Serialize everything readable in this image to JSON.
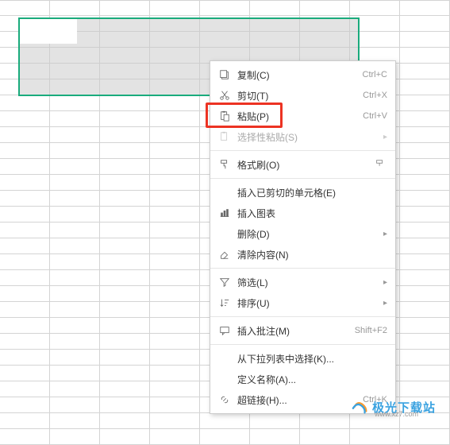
{
  "menu": {
    "copy": {
      "label": "复制(C)",
      "shortcut": "Ctrl+C"
    },
    "cut": {
      "label": "剪切(T)",
      "shortcut": "Ctrl+X"
    },
    "paste": {
      "label": "粘贴(P)",
      "shortcut": "Ctrl+V"
    },
    "paste_special": {
      "label": "选择性粘贴(S)"
    },
    "format_painter": {
      "label": "格式刷(O)"
    },
    "insert_cut_cells": {
      "label": "插入已剪切的单元格(E)"
    },
    "insert_chart": {
      "label": "插入图表"
    },
    "delete": {
      "label": "删除(D)"
    },
    "clear_contents": {
      "label": "清除内容(N)"
    },
    "filter": {
      "label": "筛选(L)"
    },
    "sort": {
      "label": "排序(U)"
    },
    "insert_comment": {
      "label": "插入批注(M)",
      "shortcut": "Shift+F2"
    },
    "pick_from_list": {
      "label": "从下拉列表中选择(K)..."
    },
    "define_name": {
      "label": "定义名称(A)..."
    },
    "hyperlink": {
      "label": "超链接(H)...",
      "shortcut": "Ctrl+K"
    }
  },
  "watermark": {
    "brand": "极光下载站",
    "url": "www.xz7.com"
  }
}
